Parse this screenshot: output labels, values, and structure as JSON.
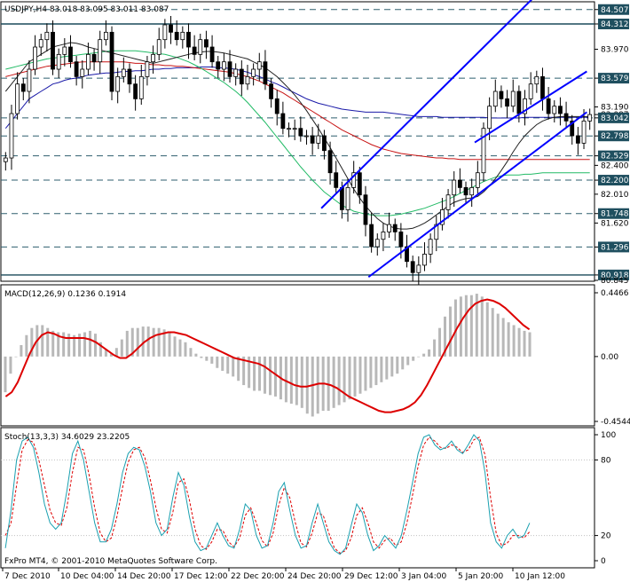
{
  "chart_data": [
    {
      "type": "candlestick",
      "title": "USDJPY,H4 83.018 83.095 83.011 83.087",
      "ylim": [
        80.845,
        84.6
      ],
      "yticks": [
        {
          "value": "84.507",
          "marked": true
        },
        {
          "value": "84.312",
          "marked": true
        },
        {
          "value": "83.970",
          "marked": false
        },
        {
          "value": "83.579",
          "marked": true
        },
        {
          "value": "83.190",
          "marked": false
        },
        {
          "value": "83.087",
          "marked": false
        },
        {
          "value": "83.042",
          "marked": true
        },
        {
          "value": "82.798",
          "marked": true
        },
        {
          "value": "82.529",
          "marked": true
        },
        {
          "value": "82.400",
          "marked": false
        },
        {
          "value": "82.200",
          "marked": true
        },
        {
          "value": "82.010",
          "marked": false
        },
        {
          "value": "81.748",
          "marked": true
        },
        {
          "value": "81.620",
          "marked": false
        },
        {
          "value": "81.296",
          "marked": true
        },
        {
          "value": "80.918",
          "marked": true
        },
        {
          "value": "80.845",
          "marked": false
        }
      ],
      "horizontal_levels": [
        84.507,
        84.312,
        83.579,
        83.042,
        82.798,
        82.529,
        82.2,
        81.748,
        81.296,
        80.918
      ],
      "solid_levels": [
        84.312,
        80.918
      ],
      "channel_lines": [
        {
          "x1": 0.54,
          "y1": 81.82,
          "x2": 0.905,
          "y2": 84.71
        },
        {
          "x1": 0.62,
          "y1": 80.89,
          "x2": 0.99,
          "y2": 83.12
        },
        {
          "x1": 0.8,
          "y1": 82.71,
          "x2": 0.99,
          "y2": 83.67
        }
      ],
      "close": [
        82.5,
        83.1,
        83.5,
        83.4,
        83.7,
        84.0,
        84.1,
        84.2,
        83.7,
        83.9,
        84.0,
        83.8,
        83.6,
        83.7,
        83.9,
        83.8,
        84.1,
        84.2,
        83.4,
        83.6,
        83.7,
        83.5,
        83.3,
        83.6,
        83.8,
        83.9,
        84.1,
        84.3,
        84.2,
        84.1,
        84.2,
        84.0,
        83.9,
        84.1,
        84.0,
        83.8,
        83.7,
        83.8,
        83.6,
        83.7,
        83.5,
        83.6,
        83.7,
        83.8,
        83.5,
        83.3,
        83.1,
        82.9,
        82.9,
        82.9,
        82.8,
        82.8,
        82.7,
        82.8,
        82.6,
        82.3,
        82.1,
        81.8,
        82.1,
        82.3,
        82.0,
        81.6,
        81.3,
        81.4,
        81.5,
        81.6,
        81.5,
        81.3,
        81.1,
        80.95,
        81.05,
        81.2,
        81.4,
        81.6,
        81.8,
        82.0,
        82.2,
        82.1,
        82.0,
        82.1,
        82.3,
        82.9,
        83.2,
        83.4,
        83.3,
        83.2,
        83.4,
        83.1,
        83.3,
        83.5,
        83.6,
        83.3,
        83.1,
        83.2,
        83.1,
        83.0,
        82.8,
        82.7,
        83.0,
        83.087
      ],
      "sma_slow": [
        82.9,
        83.0,
        83.1,
        83.2,
        83.3,
        83.35,
        83.4,
        83.45,
        83.5,
        83.52,
        83.55,
        83.57,
        83.58,
        83.6,
        83.62,
        83.63,
        83.64,
        83.65,
        83.65,
        83.66,
        83.67,
        83.67,
        83.68,
        83.68,
        83.69,
        83.7,
        83.7,
        83.71,
        83.71,
        83.72,
        83.72,
        83.72,
        83.72,
        83.73,
        83.73,
        83.73,
        83.72,
        83.72,
        83.71,
        83.7,
        83.68,
        83.66,
        83.63,
        83.6,
        83.57,
        83.53,
        83.5,
        83.46,
        83.42,
        83.38,
        83.34,
        83.3,
        83.27,
        83.24,
        83.22,
        83.2,
        83.18,
        83.16,
        83.15,
        83.14,
        83.13,
        83.12,
        83.12,
        83.12,
        83.12,
        83.11,
        83.1,
        83.09,
        83.08,
        83.07,
        83.06,
        83.06,
        83.06,
        83.06,
        83.05,
        83.05,
        83.05,
        83.05,
        83.05,
        83.05,
        83.05,
        83.05,
        83.04,
        83.04,
        83.04,
        83.04,
        83.04,
        83.04,
        83.05,
        83.05,
        83.05,
        83.05,
        83.05,
        83.05,
        83.05,
        83.05,
        83.05,
        83.05,
        83.05,
        83.05
      ],
      "sma_red": [
        83.6,
        83.62,
        83.64,
        83.66,
        83.68,
        83.7,
        83.72,
        83.74,
        83.75,
        83.76,
        83.77,
        83.78,
        83.79,
        83.8,
        83.8,
        83.8,
        83.8,
        83.8,
        83.8,
        83.8,
        83.8,
        83.79,
        83.78,
        83.78,
        83.77,
        83.76,
        83.76,
        83.75,
        83.75,
        83.74,
        83.74,
        83.73,
        83.72,
        83.71,
        83.7,
        83.69,
        83.68,
        83.67,
        83.66,
        83.64,
        83.62,
        83.6,
        83.57,
        83.54,
        83.5,
        83.46,
        83.42,
        83.38,
        83.33,
        83.28,
        83.23,
        83.18,
        83.13,
        83.08,
        83.03,
        82.98,
        82.93,
        82.88,
        82.84,
        82.8,
        82.76,
        82.72,
        82.68,
        82.65,
        82.62,
        82.6,
        82.58,
        82.56,
        82.55,
        82.54,
        82.53,
        82.52,
        82.51,
        82.5,
        82.5,
        82.49,
        82.49,
        82.48,
        82.48,
        82.48,
        82.48,
        82.48,
        82.48,
        82.48,
        82.48,
        82.48,
        82.48,
        82.48,
        82.48,
        82.48,
        82.48,
        82.48,
        82.48,
        82.48,
        82.48,
        82.48,
        82.48,
        82.48,
        82.48,
        82.48
      ],
      "sma_green": [
        83.7,
        83.72,
        83.74,
        83.76,
        83.78,
        83.8,
        83.82,
        83.84,
        83.85,
        83.86,
        83.87,
        83.88,
        83.89,
        83.9,
        83.91,
        83.92,
        83.93,
        83.94,
        83.95,
        83.95,
        83.95,
        83.95,
        83.95,
        83.94,
        83.93,
        83.92,
        83.91,
        83.9,
        83.88,
        83.86,
        83.83,
        83.8,
        83.76,
        83.72,
        83.67,
        83.62,
        83.57,
        83.52,
        83.46,
        83.4,
        83.33,
        83.25,
        83.16,
        83.07,
        82.98,
        82.88,
        82.78,
        82.68,
        82.58,
        82.48,
        82.38,
        82.29,
        82.2,
        82.12,
        82.04,
        81.98,
        81.92,
        81.86,
        81.82,
        81.78,
        81.76,
        81.74,
        81.73,
        81.72,
        81.72,
        81.72,
        81.73,
        81.74,
        81.76,
        81.78,
        81.8,
        81.82,
        81.85,
        81.88,
        81.91,
        81.94,
        81.98,
        82.02,
        82.06,
        82.1,
        82.14,
        82.18,
        82.21,
        82.24,
        82.26,
        82.27,
        82.27,
        82.27,
        82.28,
        82.28,
        82.29,
        82.3,
        82.3,
        82.3,
        82.3,
        82.3,
        82.3,
        82.3,
        82.3,
        82.3
      ],
      "sma_black": [
        83.4,
        83.5,
        83.6,
        83.7,
        83.8,
        83.85,
        83.9,
        83.95,
        84.0,
        84.02,
        84.04,
        84.06,
        84.05,
        84.03,
        84.0,
        83.98,
        83.96,
        83.94,
        83.92,
        83.9,
        83.88,
        83.86,
        83.84,
        83.82,
        83.8,
        83.78,
        83.8,
        83.82,
        83.84,
        83.86,
        83.88,
        83.9,
        83.92,
        83.93,
        83.94,
        83.94,
        83.93,
        83.92,
        83.9,
        83.88,
        83.86,
        83.84,
        83.8,
        83.76,
        83.72,
        83.66,
        83.6,
        83.52,
        83.44,
        83.35,
        83.25,
        83.14,
        83.02,
        82.9,
        82.77,
        82.64,
        82.5,
        82.36,
        82.22,
        82.08,
        81.96,
        81.85,
        81.76,
        81.68,
        81.62,
        81.58,
        81.55,
        81.54,
        81.54,
        81.55,
        81.58,
        81.62,
        81.67,
        81.73,
        81.79,
        81.85,
        81.9,
        81.93,
        81.95,
        81.96,
        81.98,
        82.04,
        82.12,
        82.22,
        82.33,
        82.45,
        82.58,
        82.7,
        82.8,
        82.88,
        82.95,
        83.0,
        83.03,
        83.05,
        83.06,
        83.06,
        83.06,
        83.06,
        83.06,
        83.06
      ]
    },
    {
      "type": "bar+line",
      "title": "MACD(12,26,9) 0.1236 0.1914",
      "ylim": [
        -0.4544,
        0.4466
      ],
      "yticks": [
        "0.4466",
        "0.00",
        "-0.4544"
      ],
      "histogram": [
        -0.25,
        -0.12,
        0.0,
        0.08,
        0.15,
        0.2,
        0.22,
        0.22,
        0.2,
        0.18,
        0.17,
        0.17,
        0.16,
        0.15,
        0.16,
        0.17,
        0.18,
        0.16,
        0.1,
        0.05,
        0.02,
        0.06,
        0.12,
        0.18,
        0.2,
        0.2,
        0.21,
        0.21,
        0.2,
        0.2,
        0.19,
        0.17,
        0.14,
        0.12,
        0.1,
        0.06,
        0.02,
        -0.01,
        -0.03,
        -0.05,
        -0.08,
        -0.1,
        -0.12,
        -0.14,
        -0.17,
        -0.2,
        -0.22,
        -0.24,
        -0.24,
        -0.26,
        -0.27,
        -0.28,
        -0.3,
        -0.32,
        -0.33,
        -0.34,
        -0.36,
        -0.4,
        -0.42,
        -0.4,
        -0.38,
        -0.38,
        -0.36,
        -0.34,
        -0.32,
        -0.3,
        -0.28,
        -0.26,
        -0.24,
        -0.22,
        -0.2,
        -0.18,
        -0.16,
        -0.14,
        -0.12,
        -0.09,
        -0.06,
        -0.03,
        0.0,
        0.02,
        0.05,
        0.12,
        0.2,
        0.28,
        0.35,
        0.4,
        0.42,
        0.43,
        0.43,
        0.44,
        0.42,
        0.38,
        0.34,
        0.3,
        0.27,
        0.24,
        0.22,
        0.2,
        0.18,
        0.17
      ],
      "signal": [
        -0.28,
        -0.25,
        -0.18,
        -0.08,
        0.02,
        0.1,
        0.15,
        0.17,
        0.16,
        0.14,
        0.13,
        0.13,
        0.13,
        0.13,
        0.12,
        0.1,
        0.07,
        0.04,
        0.01,
        -0.01,
        -0.01,
        0.02,
        0.06,
        0.1,
        0.13,
        0.15,
        0.16,
        0.17,
        0.17,
        0.16,
        0.15,
        0.13,
        0.11,
        0.09,
        0.07,
        0.05,
        0.03,
        0.01,
        -0.01,
        -0.02,
        -0.03,
        -0.04,
        -0.05,
        -0.07,
        -0.1,
        -0.13,
        -0.16,
        -0.18,
        -0.2,
        -0.21,
        -0.21,
        -0.2,
        -0.19,
        -0.19,
        -0.2,
        -0.22,
        -0.25,
        -0.28,
        -0.3,
        -0.32,
        -0.34,
        -0.36,
        -0.38,
        -0.39,
        -0.39,
        -0.38,
        -0.37,
        -0.35,
        -0.32,
        -0.27,
        -0.2,
        -0.12,
        -0.04,
        0.04,
        0.12,
        0.2,
        0.27,
        0.33,
        0.37,
        0.39,
        0.4,
        0.39,
        0.37,
        0.34,
        0.3,
        0.26,
        0.22,
        0.19
      ]
    },
    {
      "type": "line",
      "title": "Stoch(13,3,3) 34.6029 23.2205",
      "ylim": [
        0,
        100
      ],
      "yticks": [
        "100",
        "80",
        "20",
        "0"
      ],
      "main": [
        10,
        40,
        80,
        95,
        98,
        90,
        70,
        45,
        30,
        25,
        30,
        55,
        85,
        95,
        80,
        55,
        30,
        15,
        15,
        25,
        45,
        70,
        85,
        90,
        88,
        75,
        55,
        30,
        20,
        25,
        50,
        70,
        60,
        35,
        15,
        8,
        10,
        20,
        30,
        20,
        12,
        10,
        25,
        45,
        40,
        20,
        10,
        12,
        30,
        55,
        62,
        40,
        20,
        10,
        12,
        30,
        45,
        30,
        15,
        8,
        5,
        10,
        28,
        45,
        38,
        20,
        8,
        12,
        20,
        15,
        10,
        20,
        40,
        62,
        85,
        98,
        100,
        92,
        88,
        90,
        95,
        88,
        85,
        92,
        100,
        95,
        70,
        30,
        15,
        10,
        20,
        25,
        18,
        20,
        30
      ],
      "signal": [
        20,
        30,
        60,
        88,
        96,
        94,
        80,
        60,
        40,
        30,
        28,
        42,
        70,
        90,
        88,
        68,
        42,
        22,
        15,
        18,
        35,
        58,
        78,
        88,
        90,
        82,
        64,
        42,
        25,
        22,
        38,
        62,
        65,
        48,
        25,
        12,
        9,
        15,
        25,
        24,
        15,
        11,
        18,
        36,
        42,
        30,
        16,
        11,
        22,
        44,
        58,
        50,
        30,
        14,
        11,
        22,
        38,
        36,
        22,
        10,
        6,
        8,
        18,
        36,
        42,
        30,
        15,
        10,
        16,
        18,
        12,
        15,
        30,
        52,
        75,
        92,
        98,
        95,
        90,
        89,
        92,
        90,
        86,
        88,
        96,
        98,
        84,
        50,
        22,
        12,
        14,
        20,
        20,
        18,
        23
      ]
    }
  ],
  "xticks": [
    "7 Dec 2010",
    "10 Dec 04:00",
    "14 Dec 20:00",
    "17 Dec 12:00",
    "22 Dec 20:00",
    "24 Dec 20:00",
    "29 Dec 12:00",
    "3 Jan 04:00",
    "5 Jan 20:00",
    "10 Jan 12:00"
  ],
  "footer": "FxPro MT4, © 2001-2010 MetaQuotes Software Corp."
}
